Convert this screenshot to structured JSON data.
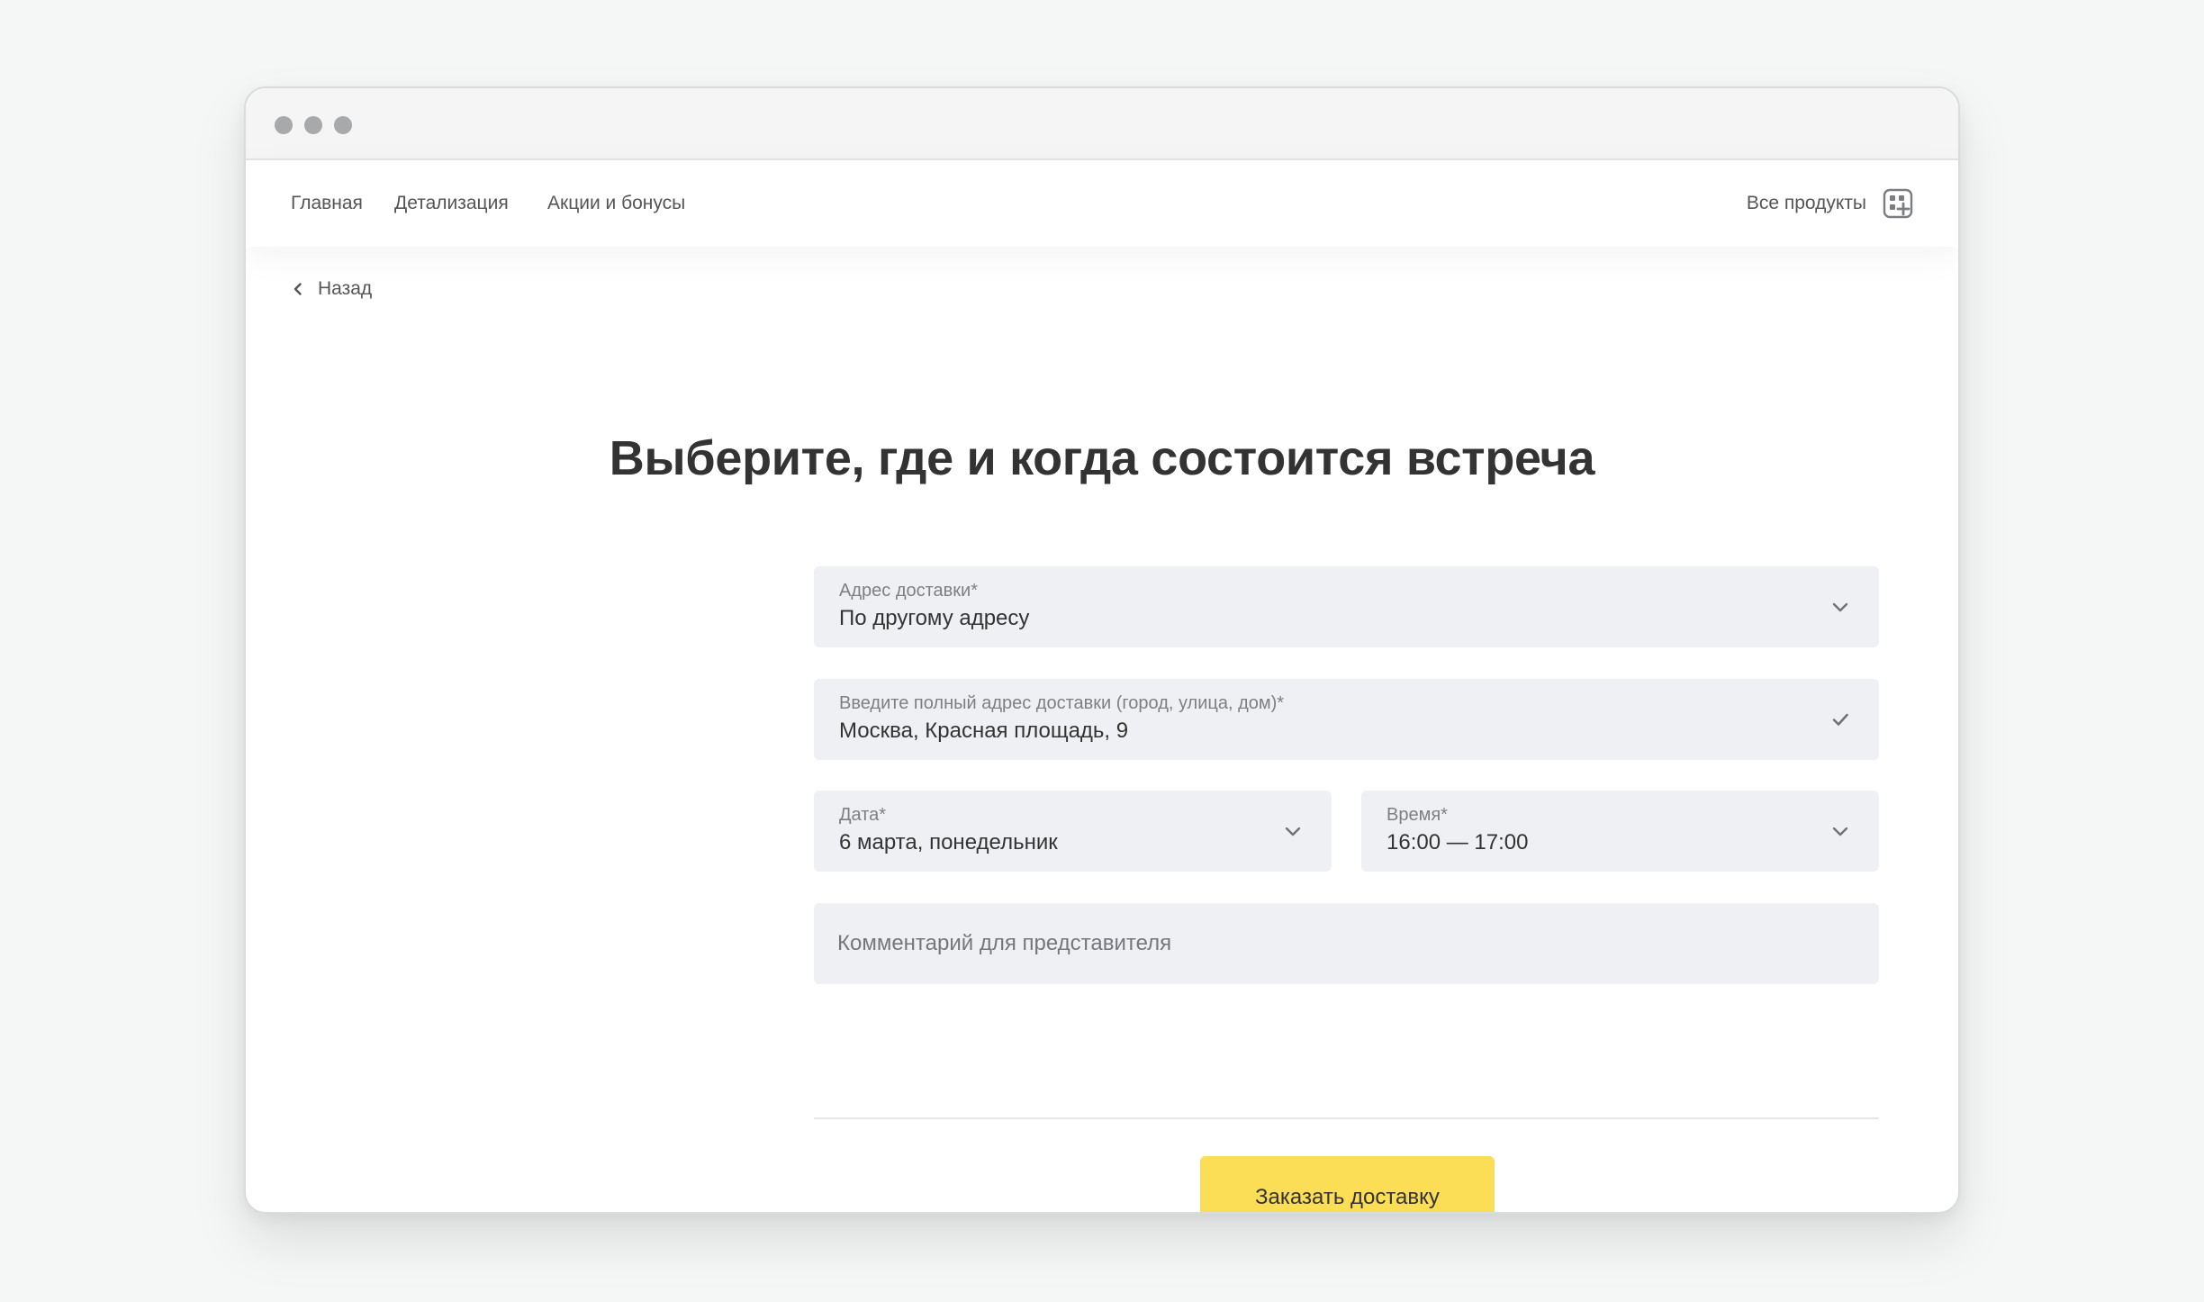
{
  "nav": {
    "links": [
      {
        "label": "Главная"
      },
      {
        "label": "Детализация"
      },
      {
        "label": "Акции и бонусы"
      }
    ],
    "all_products": "Все продукты"
  },
  "back": {
    "label": "Назад"
  },
  "page": {
    "title": "Выберите, где и когда состоится встреча"
  },
  "form": {
    "delivery_address": {
      "label": "Адрес доставки*",
      "value": "По другому адресу"
    },
    "full_address": {
      "label": "Введите полный адрес доставки (город, улица, дом)*",
      "value": "Москва, Красная площадь, 9"
    },
    "date": {
      "label": "Дата*",
      "value": "6 марта, понедельник"
    },
    "time": {
      "label": "Время*",
      "value": "16:00 — 17:00"
    },
    "comment": {
      "placeholder": "Комментарий для представителя"
    },
    "submit_label": "Заказать доставку"
  },
  "colors": {
    "accent": "#fcdd56",
    "field_bg": "#eef0f3",
    "page_bg": "#f5f6f6"
  }
}
